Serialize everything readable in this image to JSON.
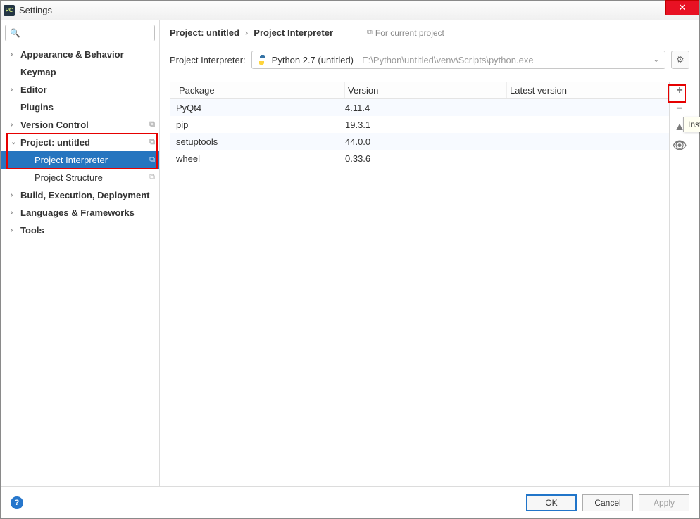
{
  "window": {
    "title": "Settings",
    "close_icon": "✕"
  },
  "search": {
    "placeholder": ""
  },
  "sidebar": {
    "items": [
      {
        "label": "Appearance & Behavior",
        "expandable": true,
        "bold": true
      },
      {
        "label": "Keymap",
        "bold": true
      },
      {
        "label": "Editor",
        "expandable": true,
        "bold": true
      },
      {
        "label": "Plugins",
        "bold": true
      },
      {
        "label": "Version Control",
        "expandable": true,
        "bold": true,
        "copy": true
      },
      {
        "label": "Project: untitled",
        "expandable": true,
        "expanded": true,
        "bold": true,
        "copy": true
      },
      {
        "label": "Project Interpreter",
        "level": 2,
        "selected": true,
        "copy": true
      },
      {
        "label": "Project Structure",
        "level": 2,
        "copy": true
      },
      {
        "label": "Build, Execution, Deployment",
        "expandable": true,
        "bold": true
      },
      {
        "label": "Languages & Frameworks",
        "expandable": true,
        "bold": true
      },
      {
        "label": "Tools",
        "expandable": true,
        "bold": true
      }
    ]
  },
  "content": {
    "breadcrumb": [
      "Project: untitled",
      "Project Interpreter"
    ],
    "for_current": "For current project",
    "interp_label": "Project Interpreter:",
    "interp_selected": "Python 2.7 (untitled)",
    "interp_path": "E:\\Python\\untitled\\venv\\Scripts\\python.exe",
    "table": {
      "headers": [
        "Package",
        "Version",
        "Latest version"
      ],
      "rows": [
        {
          "pkg": "PyQt4",
          "ver": "4.11.4",
          "latest": ""
        },
        {
          "pkg": "pip",
          "ver": "19.3.1",
          "latest": ""
        },
        {
          "pkg": "setuptools",
          "ver": "44.0.0",
          "latest": ""
        },
        {
          "pkg": "wheel",
          "ver": "0.33.6",
          "latest": ""
        }
      ]
    },
    "tooltip": "Inst"
  },
  "buttons": {
    "ok": "OK",
    "cancel": "Cancel",
    "apply": "Apply"
  }
}
